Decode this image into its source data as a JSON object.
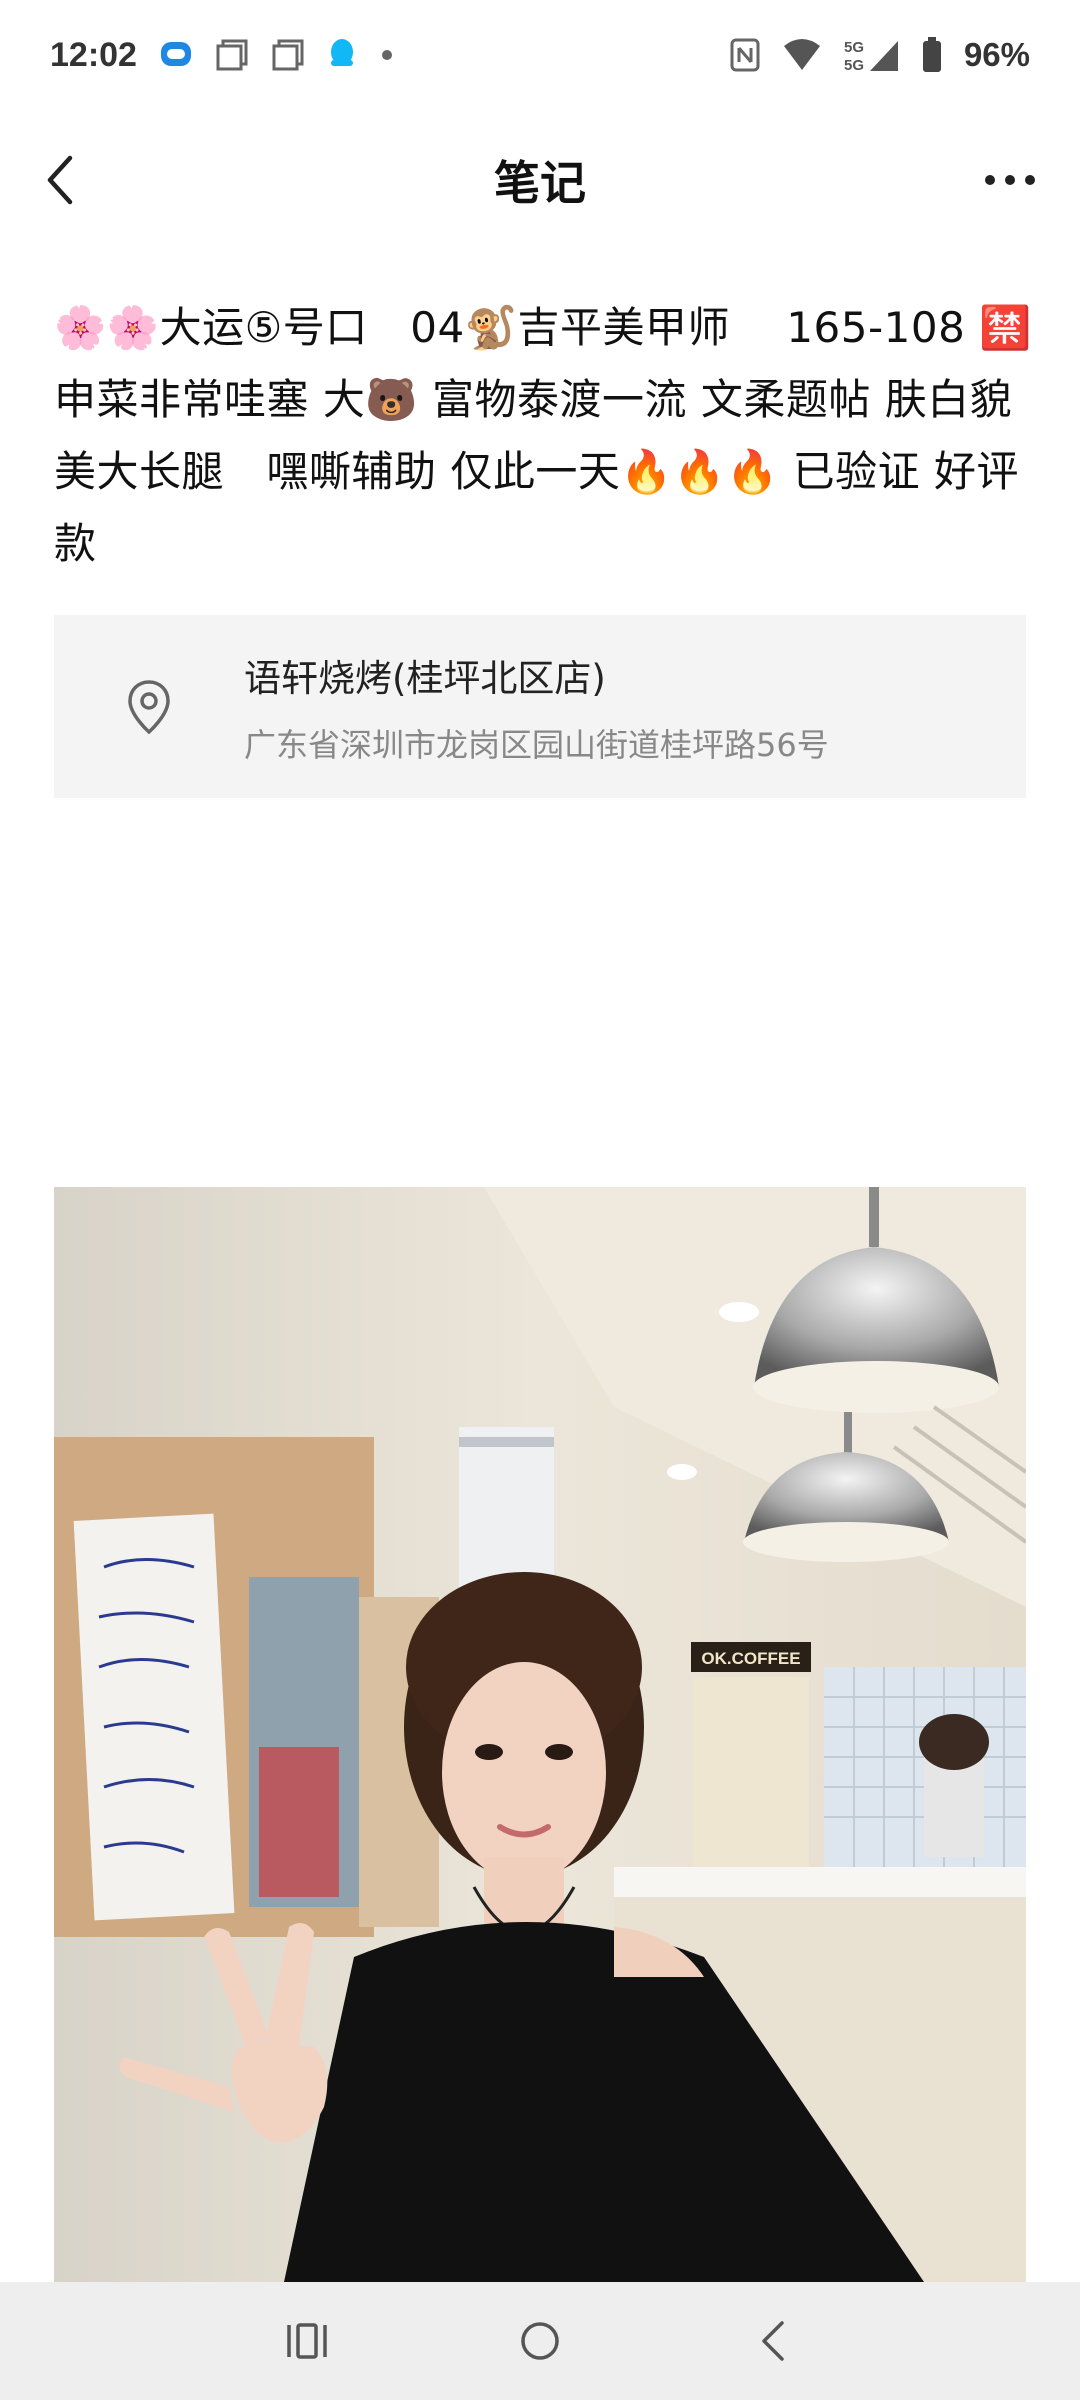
{
  "status_bar": {
    "time": "12:02",
    "battery": "96%",
    "icons_left": [
      "chat-bubble-icon",
      "window-icon",
      "window-icon",
      "qq-penguin-icon",
      "dot-icon"
    ],
    "icons_right": [
      "nfc-icon",
      "wifi-icon",
      "5g-signal-icon",
      "battery-icon"
    ]
  },
  "header": {
    "title": "笔记",
    "back_icon": "chevron-left-icon",
    "more_icon": "more-dots-icon"
  },
  "note": {
    "text": "🌸🌸大运⑤号口　04🐒吉平美甲师　 165-108 🈲　 申菜非常哇塞 大🐻 富物泰渡一流 文柔题帖 肤白貌美大长腿　嘿嘶辅助 仅此一天🔥🔥🔥 已验证 好评款"
  },
  "location": {
    "icon": "location-pin-icon",
    "name": "语轩烧烤(桂坪北区店)",
    "address": "广东省深圳市龙岗区园山街道桂坪路56号"
  },
  "photo": {
    "sign_text": "OK.COFFEE",
    "colors": {
      "wall": "#e8e1d3",
      "ceiling": "#efe9de",
      "shirt": "#111111",
      "hair": "#3a2418",
      "skin": "#f2d3c2"
    }
  },
  "nav_bar": {
    "recent_icon": "recent-apps-icon",
    "home_icon": "home-circle-icon",
    "back_icon": "back-chevron-icon"
  }
}
